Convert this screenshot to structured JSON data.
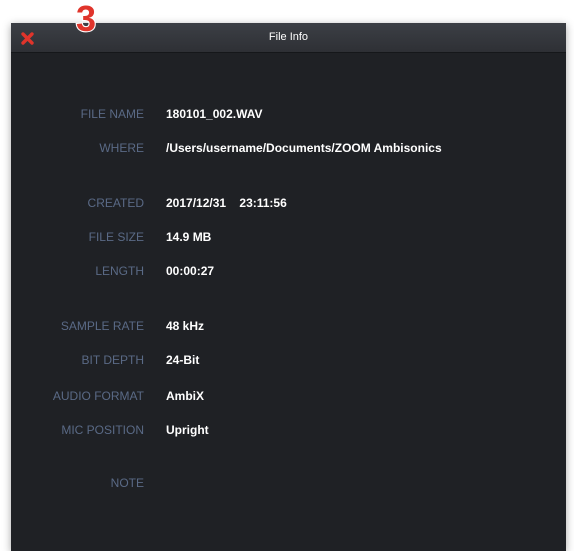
{
  "window": {
    "title": "File Info"
  },
  "step_badge": "3",
  "icons": {
    "close": "close-icon",
    "badge": "step-number-badge"
  },
  "colors": {
    "background": "#1f2125",
    "label": "#5a6a86",
    "value": "#ffffff",
    "close": "#e0342b",
    "badge": "#e0342b"
  },
  "fields": {
    "file_name": {
      "label": "FILE NAME",
      "value": "180101_002.WAV"
    },
    "where": {
      "label": "WHERE",
      "value": "/Users/username/Documents/ZOOM Ambisonics"
    },
    "created": {
      "label": "CREATED",
      "value": "2017/12/31    23:11:56"
    },
    "file_size": {
      "label": "FILE SIZE",
      "value": "14.9 MB"
    },
    "length": {
      "label": "LENGTH",
      "value": "00:00:27"
    },
    "sample_rate": {
      "label": "SAMPLE RATE",
      "value": "48 kHz"
    },
    "bit_depth": {
      "label": "BIT DEPTH",
      "value": "24-Bit"
    },
    "audio_format": {
      "label": "AUDIO FORMAT",
      "value": "AmbiX"
    },
    "mic_position": {
      "label": "MIC POSITION",
      "value": "Upright"
    },
    "note": {
      "label": "NOTE",
      "value": ""
    }
  }
}
